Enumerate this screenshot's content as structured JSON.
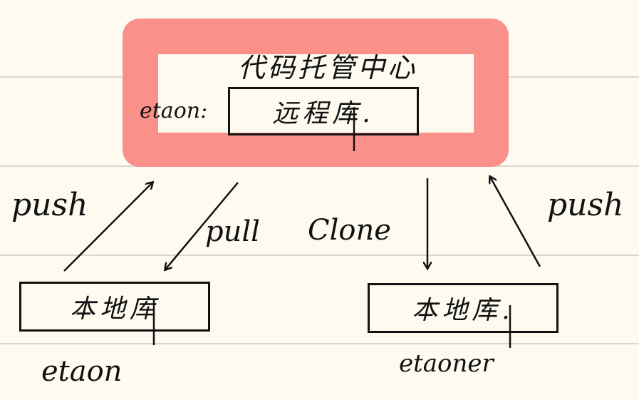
{
  "hub": {
    "title": "代码托管中心",
    "remote_repo": "远程库.",
    "owner": "etaon:"
  },
  "left": {
    "local_repo": "本地库",
    "user": "etaon",
    "push_label": "push",
    "pull_label": "pull"
  },
  "right": {
    "local_repo": "本地库.",
    "user": "etaoner",
    "clone_label": "Clone",
    "push_label": "push"
  },
  "colors": {
    "hub_frame": "#f9918a",
    "ink": "#111111",
    "paper": "#fdfaef",
    "rule_line": "#d9d6cc"
  }
}
